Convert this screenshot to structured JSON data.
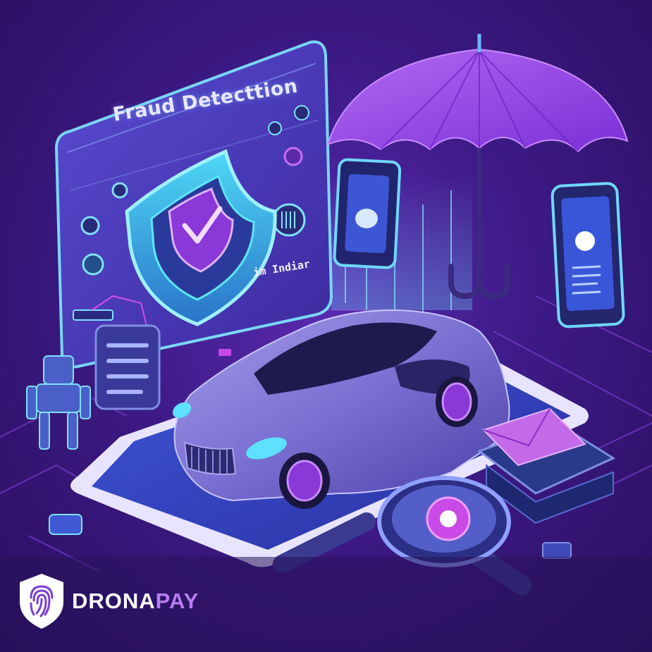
{
  "scene": {
    "panel_title": "Fraud Detecttion",
    "panel_subtitle": "im Indiar"
  },
  "brand": {
    "name_part1": "DRONA",
    "name_part2": "PAY",
    "logo_icon": "fingerprint-shield-icon"
  },
  "colors": {
    "background": "#3d1a86",
    "accent_purple": "#a24fe8",
    "accent_cyan": "#3fd4f5",
    "brand_white": "#ffffff",
    "brand_purple": "#b67cf0"
  }
}
